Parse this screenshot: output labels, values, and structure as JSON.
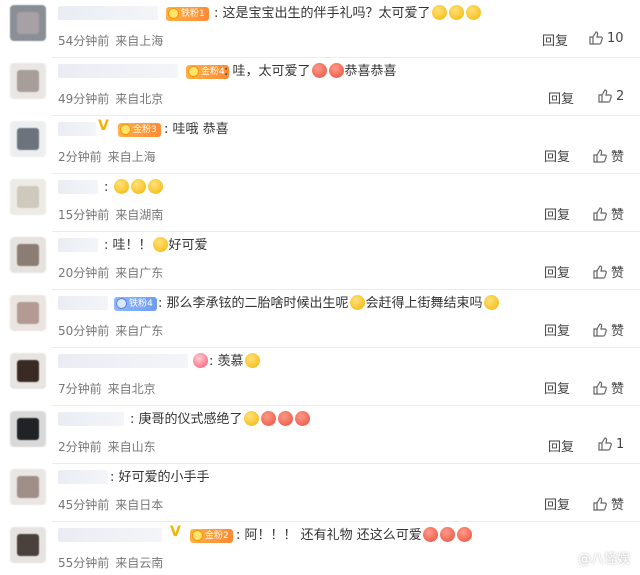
{
  "comments": [
    {
      "text": "这是宝宝出生的伴手礼吗？太可爱了",
      "badge": "铁粉1",
      "time": "54分钟前",
      "location": "来自上海",
      "reply": "回复",
      "likes": "10"
    },
    {
      "text": "哇，太可爱了",
      "text2": "恭喜恭喜",
      "badge": "金粉4",
      "time": "49分钟前",
      "location": "来自北京",
      "reply": "回复",
      "likes": "2"
    },
    {
      "text": "哇哦 恭喜",
      "badge": "金粉3",
      "time": "2分钟前",
      "location": "来自上海",
      "reply": "回复",
      "likes": "赞"
    },
    {
      "text": "",
      "time": "15分钟前",
      "location": "来自湖南",
      "reply": "回复",
      "likes": "赞"
    },
    {
      "text": "哇！！",
      "text2": "好可爱",
      "time": "20分钟前",
      "location": "来自广东",
      "reply": "回复",
      "likes": "赞"
    },
    {
      "text": "那么李承铉的二胎啥时候出生呢",
      "text2": "会赶得上街舞结束吗",
      "badge": "铁粉4",
      "time": "50分钟前",
      "location": "来自广东",
      "reply": "回复",
      "likes": "赞"
    },
    {
      "text": "羡慕",
      "time": "7分钟前",
      "location": "来自北京",
      "reply": "回复",
      "likes": "赞"
    },
    {
      "text": "庚哥的仪式感绝了",
      "time": "2分钟前",
      "location": "来自山东",
      "reply": "回复",
      "likes": "1"
    },
    {
      "text": "好可爱的小手手",
      "time": "45分钟前",
      "location": "来自日本",
      "reply": "回复",
      "likes": "赞"
    },
    {
      "text": "阿！！！ 还有礼物 还这么可爱",
      "badge": "金粉2",
      "time": "55分钟前",
      "location": "来自云南",
      "reply": "回复",
      "likes": "赞"
    }
  ],
  "watermark": "@八怪娱",
  "icons": {
    "like": "thumbs-up-icon",
    "emoji": "emoji-icon",
    "badge": "fan-badge-icon",
    "vip": "vip-v-icon",
    "logo": "watermark-logo-icon"
  },
  "colors": {
    "badge_gold": "#ff9a3c",
    "badge_iron": "#7fa8f7",
    "vip": "#f5b400",
    "meta": "#777777"
  }
}
